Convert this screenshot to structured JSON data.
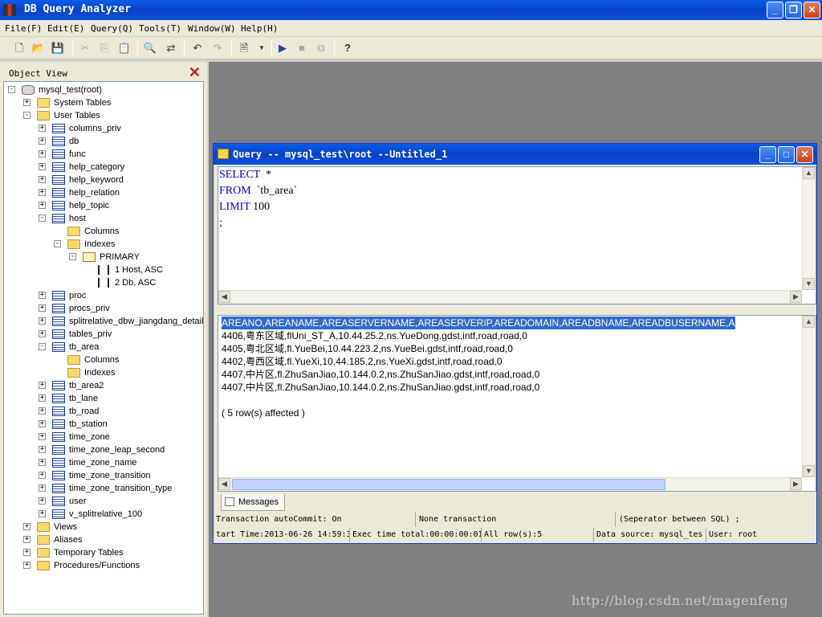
{
  "window": {
    "title": "DB Query Analyzer",
    "icon": "app-icon"
  },
  "menu": [
    "File(F)",
    "Edit(E)",
    "Query(Q)",
    "Tools(T)",
    "Window(W)",
    "Help(H)"
  ],
  "object_view": {
    "title": "Object View",
    "tree": [
      {
        "label": "mysql_test(root)",
        "icon": "database-icon",
        "level": 0,
        "state": "-"
      },
      {
        "label": "System Tables",
        "icon": "folder-icon",
        "level": 1,
        "state": "+"
      },
      {
        "label": "User Tables",
        "icon": "folder-icon",
        "level": 1,
        "state": "-"
      },
      {
        "label": "columns_priv",
        "icon": "table-icon",
        "level": 2,
        "state": "+"
      },
      {
        "label": "db",
        "icon": "table-icon",
        "level": 2,
        "state": "+"
      },
      {
        "label": "func",
        "icon": "table-icon",
        "level": 2,
        "state": "+"
      },
      {
        "label": "help_category",
        "icon": "table-icon",
        "level": 2,
        "state": "+"
      },
      {
        "label": "help_keyword",
        "icon": "table-icon",
        "level": 2,
        "state": "+"
      },
      {
        "label": "help_relation",
        "icon": "table-icon",
        "level": 2,
        "state": "+"
      },
      {
        "label": "help_topic",
        "icon": "table-icon",
        "level": 2,
        "state": "+"
      },
      {
        "label": "host",
        "icon": "table-icon",
        "level": 2,
        "state": "-"
      },
      {
        "label": "Columns",
        "icon": "folder-icon",
        "level": 3,
        "state": ""
      },
      {
        "label": "Indexes",
        "icon": "folder-icon",
        "level": 3,
        "state": "-"
      },
      {
        "label": "PRIMARY",
        "icon": "key-icon",
        "level": 4,
        "state": "-"
      },
      {
        "label": "1  Host, ASC",
        "icon": "column-icon",
        "level": 5,
        "state": ""
      },
      {
        "label": "2  Db, ASC",
        "icon": "column-icon",
        "level": 5,
        "state": ""
      },
      {
        "label": "proc",
        "icon": "table-icon",
        "level": 2,
        "state": "+"
      },
      {
        "label": "procs_priv",
        "icon": "table-icon",
        "level": 2,
        "state": "+"
      },
      {
        "label": "splitrelative_dbw_jiangdang_detail",
        "icon": "table-icon",
        "level": 2,
        "state": "+"
      },
      {
        "label": "tables_priv",
        "icon": "table-icon",
        "level": 2,
        "state": "+"
      },
      {
        "label": "tb_area",
        "icon": "table-icon",
        "level": 2,
        "state": "-"
      },
      {
        "label": "Columns",
        "icon": "folder-icon",
        "level": 3,
        "state": ""
      },
      {
        "label": "Indexes",
        "icon": "folder-icon",
        "level": 3,
        "state": ""
      },
      {
        "label": "tb_area2",
        "icon": "table-icon",
        "level": 2,
        "state": "+"
      },
      {
        "label": "tb_lane",
        "icon": "table-icon",
        "level": 2,
        "state": "+"
      },
      {
        "label": "tb_road",
        "icon": "table-icon",
        "level": 2,
        "state": "+"
      },
      {
        "label": "tb_station",
        "icon": "table-icon",
        "level": 2,
        "state": "+"
      },
      {
        "label": "time_zone",
        "icon": "table-icon",
        "level": 2,
        "state": "+"
      },
      {
        "label": "time_zone_leap_second",
        "icon": "table-icon",
        "level": 2,
        "state": "+"
      },
      {
        "label": "time_zone_name",
        "icon": "table-icon",
        "level": 2,
        "state": "+"
      },
      {
        "label": "time_zone_transition",
        "icon": "table-icon",
        "level": 2,
        "state": "+"
      },
      {
        "label": "time_zone_transition_type",
        "icon": "table-icon",
        "level": 2,
        "state": "+"
      },
      {
        "label": "user",
        "icon": "table-icon",
        "level": 2,
        "state": "+"
      },
      {
        "label": "v_splitrelative_100",
        "icon": "table-icon",
        "level": 2,
        "state": "+"
      },
      {
        "label": "Views",
        "icon": "folder-icon",
        "level": 1,
        "state": "+"
      },
      {
        "label": "Aliases",
        "icon": "folder-icon",
        "level": 1,
        "state": "+"
      },
      {
        "label": "Temporary Tables",
        "icon": "folder-icon",
        "level": 1,
        "state": "+"
      },
      {
        "label": "Procedures/Functions",
        "icon": "folder-icon",
        "level": 1,
        "state": "+"
      }
    ]
  },
  "query_window": {
    "title": "Query -- mysql_test\\root  --Untitled_1",
    "sql": [
      {
        "kw": "SELECT",
        "rest": "  *"
      },
      {
        "kw": "FROM",
        "rest": "  `tb_area`"
      },
      {
        "kw": "LIMIT",
        "rest": " 100"
      },
      {
        "kw": "",
        "rest": ";"
      }
    ],
    "results": {
      "header": "AREANO,AREANAME,AREASERVERNAME,AREASERVERIP,AREADOMAIN,AREADBNAME,AREADBUSERNAME,A",
      "rows": [
        "4406,粤东区域,flUni_ST_A,10.44.25.2,ns.YueDong.gdst,intf,road,road,0",
        "4405,粤北区域,fl.YueBei,10.44.223.2,ns.YueBei.gdst,intf,road,road,0",
        "4402,粤西区域,fl.YueXi,10.44.185.2,ns.YueXi.gdst,intf,road,road,0",
        "4407,中片区,fl.ZhuSanJiao,10.144.0.2,ns.ZhuSanJiao.gdst,intf,road,road,0",
        "4407,中片区,fl.ZhuSanJiao,10.144.0.2,ns.ZhuSanJiao.gdst,intf,road,road,0"
      ],
      "affected": "( 5 row(s) affected )"
    },
    "tab_label": "Messages",
    "status": {
      "autocommit": "Transaction autoCommit: On",
      "transaction": "None transaction",
      "separator": "(Seperator between SQL)   ;",
      "start_time": "tart Time:2013-06-26 14:59:3",
      "exec_time": "Exec time total:00:00:00:01",
      "rows": "All row(s):5",
      "datasource": "Data source: mysql_tes",
      "user": "User: root"
    }
  },
  "watermark": "http://blog.csdn.net/magenfeng"
}
